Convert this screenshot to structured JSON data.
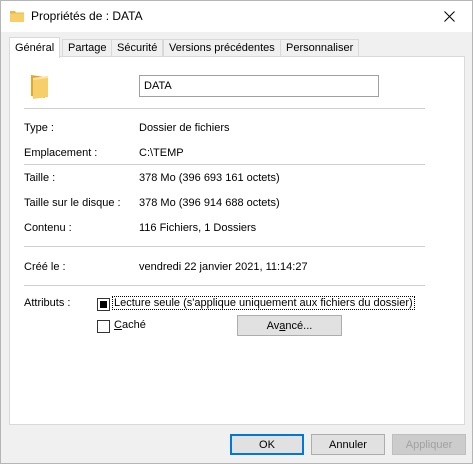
{
  "window": {
    "title": "Propriétés de : DATA"
  },
  "tabs": [
    {
      "label": "Général",
      "active": true
    },
    {
      "label": "Partage",
      "active": false
    },
    {
      "label": "Sécurité",
      "active": false
    },
    {
      "label": "Versions précédentes",
      "active": false
    },
    {
      "label": "Personnaliser",
      "active": false
    }
  ],
  "general": {
    "name_value": "DATA",
    "rows": [
      {
        "label": "Type :",
        "value": "Dossier de fichiers"
      },
      {
        "label": "Emplacement :",
        "value": "C:\\TEMP"
      },
      {
        "label": "Taille :",
        "value": "378 Mo (396 693 161 octets)"
      },
      {
        "label": "Taille sur le disque :",
        "value": "378 Mo (396 914 688 octets)"
      },
      {
        "label": "Contenu :",
        "value": "116 Fichiers, 1 Dossiers"
      },
      {
        "label": "Créé le :",
        "value": "vendredi 22 janvier 2021, 11:14:27"
      }
    ],
    "attributes_label": "Attributs :",
    "readonly_label_pre": "Lecture seule",
    "readonly_label_post": " (s'applique uniquement aux fichiers du dossier)",
    "hidden_label_pre": "",
    "hidden_label_mn": "C",
    "hidden_label_post": "aché",
    "advanced_pre": "Av",
    "advanced_mn": "a",
    "advanced_post": "ncé..."
  },
  "buttons": {
    "ok": "OK",
    "cancel": "Annuler",
    "apply": "Appliquer"
  },
  "colors": {
    "accent": "#0078d7",
    "folder": "#f4c95d"
  }
}
